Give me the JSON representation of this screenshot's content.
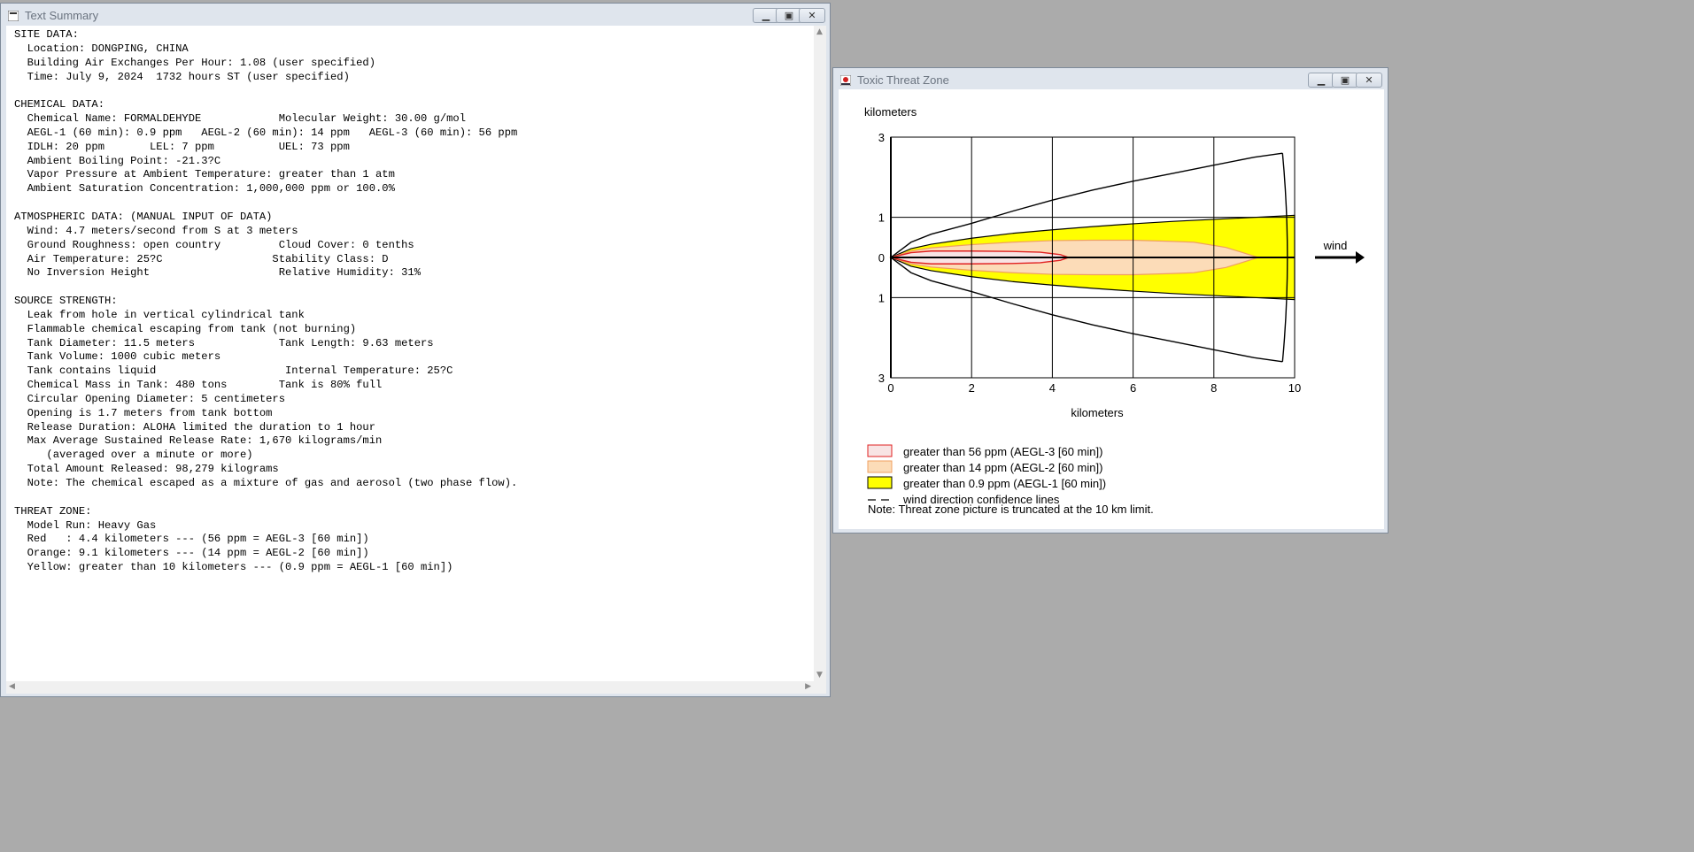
{
  "summary_window": {
    "title": "Text Summary",
    "lines": [
      "SITE DATA:",
      "  Location: DONGPING, CHINA",
      "  Building Air Exchanges Per Hour: 1.08 (user specified)",
      "  Time: July 9, 2024  1732 hours ST (user specified)",
      "",
      "CHEMICAL DATA:",
      "  Chemical Name: FORMALDEHYDE            Molecular Weight: 30.00 g/mol",
      "  AEGL-1 (60 min): 0.9 ppm   AEGL-2 (60 min): 14 ppm   AEGL-3 (60 min): 56 ppm",
      "  IDLH: 20 ppm       LEL: 7 ppm          UEL: 73 ppm",
      "  Ambient Boiling Point: -21.3?C",
      "  Vapor Pressure at Ambient Temperature: greater than 1 atm",
      "  Ambient Saturation Concentration: 1,000,000 ppm or 100.0%",
      "",
      "ATMOSPHERIC DATA: (MANUAL INPUT OF DATA)",
      "  Wind: 4.7 meters/second from S at 3 meters",
      "  Ground Roughness: open country         Cloud Cover: 0 tenths",
      "  Air Temperature: 25?C                 Stability Class: D",
      "  No Inversion Height                    Relative Humidity: 31%",
      "",
      "SOURCE STRENGTH:",
      "  Leak from hole in vertical cylindrical tank",
      "  Flammable chemical escaping from tank (not burning)",
      "  Tank Diameter: 11.5 meters             Tank Length: 9.63 meters",
      "  Tank Volume: 1000 cubic meters",
      "  Tank contains liquid                    Internal Temperature: 25?C",
      "  Chemical Mass in Tank: 480 tons        Tank is 80% full",
      "  Circular Opening Diameter: 5 centimeters",
      "  Opening is 1.7 meters from tank bottom",
      "  Release Duration: ALOHA limited the duration to 1 hour",
      "  Max Average Sustained Release Rate: 1,670 kilograms/min",
      "     (averaged over a minute or more)",
      "  Total Amount Released: 98,279 kilograms",
      "  Note: The chemical escaped as a mixture of gas and aerosol (two phase flow).",
      "",
      "THREAT ZONE:",
      "  Model Run: Heavy Gas",
      "  Red   : 4.4 kilometers --- (56 ppm = AEGL-3 [60 min])",
      "  Orange: 9.1 kilometers --- (14 ppm = AEGL-2 [60 min])",
      "  Yellow: greater than 10 kilometers --- (0.9 ppm = AEGL-1 [60 min])"
    ]
  },
  "threat_window": {
    "title": "Toxic Threat Zone",
    "y_unit_label": "kilometers",
    "x_axis_label": "kilometers",
    "wind_label": "wind",
    "legend": [
      {
        "label": "greater than 56 ppm (AEGL-3 [60 min])",
        "color": "#f8e4e4",
        "edge": "#e02020"
      },
      {
        "label": "greater than 14 ppm (AEGL-2 [60 min])",
        "color": "#fcdcb8",
        "edge": "#f0a060"
      },
      {
        "label": "greater than 0.9 ppm (AEGL-1 [60 min])",
        "color": "#ffff00",
        "edge": "#000000"
      },
      {
        "label": "wind direction confidence lines",
        "color": "",
        "edge": "#000000"
      }
    ],
    "note": "Note: Threat zone picture is truncated at the 10 km limit."
  },
  "chart_data": {
    "type": "area",
    "xlabel": "kilometers",
    "ylabel": "kilometers",
    "xlim": [
      0,
      10
    ],
    "ylim": [
      -3,
      3
    ],
    "x_ticks": [
      "0",
      "2",
      "4",
      "6",
      "8",
      "10"
    ],
    "y_ticks": [
      "3",
      "1",
      "0",
      "1",
      "3"
    ],
    "grid": true,
    "series": [
      {
        "name": "greater than 0.9 ppm (AEGL-1 [60 min])",
        "x": [
          0,
          0.5,
          1,
          2,
          3,
          4,
          5,
          6,
          7,
          8,
          9,
          10
        ],
        "half_width": [
          0,
          0.22,
          0.33,
          0.48,
          0.6,
          0.69,
          0.77,
          0.84,
          0.9,
          0.95,
          1.0,
          1.05
        ]
      },
      {
        "name": "greater than 14 ppm (AEGL-2 [60 min])",
        "x": [
          0,
          0.5,
          1,
          2,
          3,
          4,
          5,
          6,
          7,
          7.5,
          8.3,
          9.1
        ],
        "half_width": [
          0,
          0.16,
          0.24,
          0.32,
          0.38,
          0.42,
          0.43,
          0.43,
          0.4,
          0.38,
          0.25,
          0
        ]
      },
      {
        "name": "greater than 56 ppm (AEGL-3 [60 min])",
        "x": [
          0,
          0.5,
          1,
          2,
          3,
          3.7,
          4.2,
          4.4
        ],
        "half_width": [
          0,
          0.12,
          0.16,
          0.16,
          0.15,
          0.13,
          0.07,
          0
        ]
      },
      {
        "name": "wind direction confidence lines",
        "x": [
          0,
          0.5,
          1,
          2,
          3,
          4,
          5,
          6,
          7,
          8,
          9,
          9.7
        ],
        "half_width": [
          0,
          0.38,
          0.58,
          0.85,
          1.15,
          1.43,
          1.68,
          1.9,
          2.1,
          2.3,
          2.5,
          2.6
        ]
      }
    ]
  }
}
